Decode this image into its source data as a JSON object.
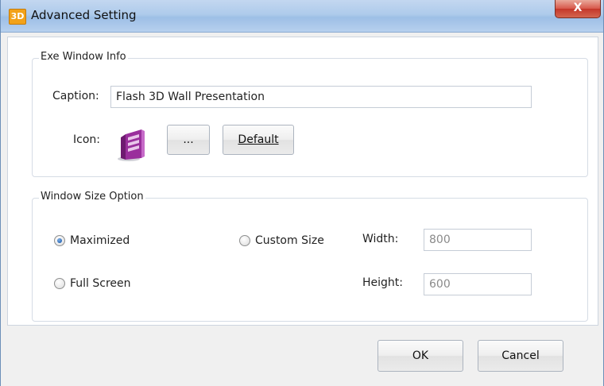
{
  "window": {
    "title": "Advanced Setting",
    "app_icon_text": "3D",
    "close_glyph": "X"
  },
  "exe_group": {
    "label": "Exe Window Info",
    "caption_label": "Caption:",
    "caption_value": "Flash 3D Wall Presentation",
    "icon_label": "Icon:",
    "browse_label": "...",
    "default_label": "Default"
  },
  "size_group": {
    "label": "Window Size Option",
    "maximized_label": "Maximized",
    "fullscreen_label": "Full Screen",
    "custom_label": "Custom Size",
    "width_label": "Width:",
    "width_value": "800",
    "height_label": "Height:",
    "height_value": "600",
    "selected": "Maximized"
  },
  "footer": {
    "ok_label": "OK",
    "cancel_label": "Cancel"
  },
  "colors": {
    "accent": "#1f5fb0",
    "icon_purple": "#9a2f9c"
  }
}
